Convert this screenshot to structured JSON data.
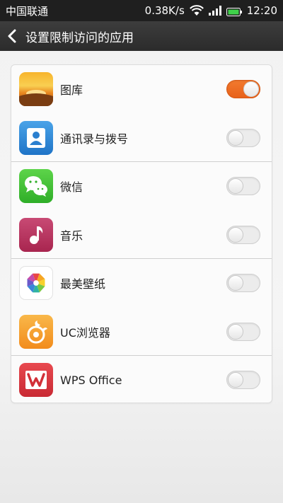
{
  "status_bar": {
    "carrier": "中国联通",
    "speed": "0.38K/s",
    "time": "12:20"
  },
  "header": {
    "title": "设置限制访问的应用"
  },
  "apps": [
    {
      "label": "图库",
      "icon": "gallery-icon",
      "enabled": true
    },
    {
      "label": "通讯录与拨号",
      "icon": "contacts-icon",
      "enabled": false
    },
    {
      "label": "微信",
      "icon": "wechat-icon",
      "enabled": false
    },
    {
      "label": "音乐",
      "icon": "music-icon",
      "enabled": false
    },
    {
      "label": "最美壁纸",
      "icon": "wallpaper-icon",
      "enabled": false
    },
    {
      "label": "UC浏览器",
      "icon": "uc-browser-icon",
      "enabled": false
    },
    {
      "label": "WPS Office",
      "icon": "wps-office-icon",
      "enabled": false
    }
  ],
  "colors": {
    "toggle_on": "#ef6f24",
    "header_bg": "#333333",
    "status_bg": "#1f1f1f"
  }
}
